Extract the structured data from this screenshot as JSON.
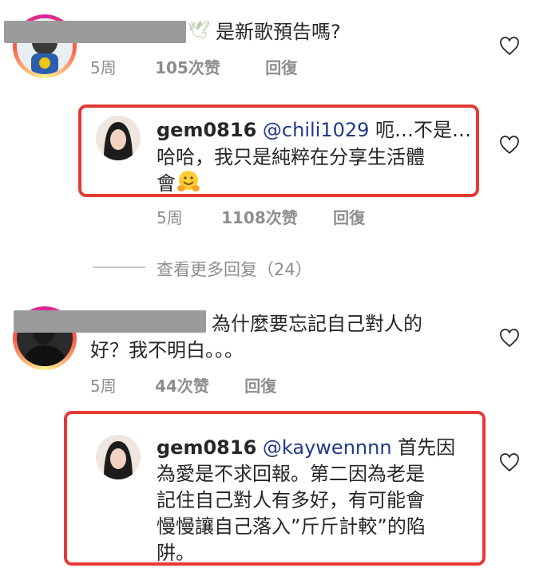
{
  "comments": [
    {
      "text": "是新歌預告嗎?",
      "time": "5周",
      "likes": "105次赞",
      "reply": "回復"
    },
    {
      "username": "gem0816",
      "mention": "@chili1029",
      "text_line1": " 呃…不是…",
      "text_line2": "哈哈，我只是純粹在分享生活體",
      "text_line3": "會",
      "emoji_icon": "hugging-face-icon",
      "time": "5周",
      "likes": "1108次赞",
      "reply": "回復"
    },
    {
      "view_more": "查看更多回复（24）"
    },
    {
      "text_line1": "為什麼要忘記自己對人的",
      "text_line2": "好？我不明白。。。",
      "time": "5周",
      "likes": "44次赞",
      "reply": "回復"
    },
    {
      "username": "gem0816",
      "mention": "@kaywennnn",
      "text_line1": " 首先因",
      "text_line2": "為愛是不求回報。第二因為老是",
      "text_line3": "記住自己對人有多好，有可能會",
      "text_line4": "慢慢讓自己落入”斤斤計較”的陷",
      "text_line5": "阱。"
    }
  ],
  "colors": {
    "highlight_border": "#e53935",
    "mention": "#1f3a8a",
    "meta": "#8e8e8e"
  }
}
